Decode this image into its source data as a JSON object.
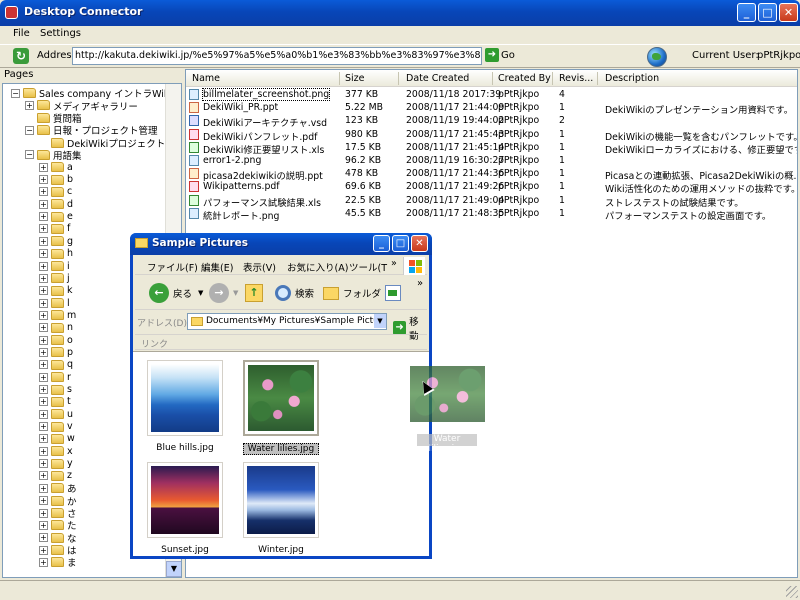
{
  "window": {
    "title": "Desktop Connector",
    "min": "_",
    "max": "□",
    "close": "✕"
  },
  "menu": {
    "file": "File",
    "settings": "Settings"
  },
  "address": {
    "label": "Address",
    "url": "http://kakuta.dekiwiki.jp/%e5%97%a5%e5%a0%b1%e3%83%bb%e3%83%97%e3%83%ad%e3%82%b8%e3%82%a7%e3",
    "go": "Go",
    "current_user_label": "Current User:",
    "current_user": "pPtRjkpo"
  },
  "tree": {
    "header": "Pages",
    "items": [
      {
        "label": "Sales company イントラWiki",
        "level": 0,
        "expander": "−",
        "folder": true
      },
      {
        "label": "メディアギャラリー",
        "level": 1,
        "expander": "+",
        "folder": true
      },
      {
        "label": "質問箱",
        "level": 1,
        "expander": "",
        "folder": true
      },
      {
        "label": "日報・プロジェクト管理",
        "level": 1,
        "expander": "−",
        "folder": true
      },
      {
        "label": "DekiWikiプロジェクト",
        "level": 2,
        "expander": "",
        "folder": true
      },
      {
        "label": "用語集",
        "level": 1,
        "expander": "−",
        "folder": true
      },
      {
        "label": "a",
        "level": 2,
        "expander": "+",
        "folder": true
      },
      {
        "label": "b",
        "level": 2,
        "expander": "+",
        "folder": true
      },
      {
        "label": "c",
        "level": 2,
        "expander": "+",
        "folder": true
      },
      {
        "label": "d",
        "level": 2,
        "expander": "+",
        "folder": true
      },
      {
        "label": "e",
        "level": 2,
        "expander": "+",
        "folder": true
      },
      {
        "label": "f",
        "level": 2,
        "expander": "+",
        "folder": true
      },
      {
        "label": "g",
        "level": 2,
        "expander": "+",
        "folder": true
      },
      {
        "label": "h",
        "level": 2,
        "expander": "+",
        "folder": true
      },
      {
        "label": "i",
        "level": 2,
        "expander": "+",
        "folder": true
      },
      {
        "label": "j",
        "level": 2,
        "expander": "+",
        "folder": true
      },
      {
        "label": "k",
        "level": 2,
        "expander": "+",
        "folder": true
      },
      {
        "label": "l",
        "level": 2,
        "expander": "+",
        "folder": true
      },
      {
        "label": "m",
        "level": 2,
        "expander": "+",
        "folder": true
      },
      {
        "label": "n",
        "level": 2,
        "expander": "+",
        "folder": true
      },
      {
        "label": "o",
        "level": 2,
        "expander": "+",
        "folder": true
      },
      {
        "label": "p",
        "level": 2,
        "expander": "+",
        "folder": true
      },
      {
        "label": "q",
        "level": 2,
        "expander": "+",
        "folder": true
      },
      {
        "label": "r",
        "level": 2,
        "expander": "+",
        "folder": true
      },
      {
        "label": "s",
        "level": 2,
        "expander": "+",
        "folder": true
      },
      {
        "label": "t",
        "level": 2,
        "expander": "+",
        "folder": true
      },
      {
        "label": "u",
        "level": 2,
        "expander": "+",
        "folder": true
      },
      {
        "label": "v",
        "level": 2,
        "expander": "+",
        "folder": true
      },
      {
        "label": "w",
        "level": 2,
        "expander": "+",
        "folder": true
      },
      {
        "label": "x",
        "level": 2,
        "expander": "+",
        "folder": true
      },
      {
        "label": "y",
        "level": 2,
        "expander": "+",
        "folder": true
      },
      {
        "label": "z",
        "level": 2,
        "expander": "+",
        "folder": true
      },
      {
        "label": "あ",
        "level": 2,
        "expander": "+",
        "folder": true
      },
      {
        "label": "か",
        "level": 2,
        "expander": "+",
        "folder": true
      },
      {
        "label": "さ",
        "level": 2,
        "expander": "+",
        "folder": true
      },
      {
        "label": "た",
        "level": 2,
        "expander": "+",
        "folder": true
      },
      {
        "label": "な",
        "level": 2,
        "expander": "+",
        "folder": true
      },
      {
        "label": "は",
        "level": 2,
        "expander": "+",
        "folder": true
      },
      {
        "label": "ま",
        "level": 2,
        "expander": "+",
        "folder": true
      }
    ],
    "scroll_down": "▼"
  },
  "files": {
    "columns": [
      "Name",
      "Size",
      "Date Created",
      "Created By",
      "Revis...",
      "Description"
    ],
    "rows": [
      {
        "icon": "png",
        "name": "billmelater_screenshot.png",
        "size": "377 KB",
        "date": "2008/11/18 2017:39",
        "by": "pPtRjkpo",
        "rev": "4",
        "desc": ""
      },
      {
        "icon": "ppt",
        "name": "DekiWiki_PR.ppt",
        "size": "5.22 MB",
        "date": "2008/11/17 21:44:09",
        "by": "pPtRjkpo",
        "rev": "1",
        "desc": "DekiWikiのプレゼンテーション用資料です。"
      },
      {
        "icon": "vsd",
        "name": "DekiWikiアーキテクチャ.vsd",
        "size": "123 KB",
        "date": "2008/11/19 19:44:02",
        "by": "pPtRjkpo",
        "rev": "2",
        "desc": ""
      },
      {
        "icon": "pdf",
        "name": "DekiWikiパンフレット.pdf",
        "size": "980 KB",
        "date": "2008/11/17 21:45:43",
        "by": "pPtRjkpo",
        "rev": "1",
        "desc": "DekiWikiの機能一覧を含むパンフレットです。"
      },
      {
        "icon": "xls",
        "name": "DekiWiki修正要望リスト.xls",
        "size": "17.5 KB",
        "date": "2008/11/17 21:45:14",
        "by": "pPtRjkpo",
        "rev": "1",
        "desc": "DekiWikiローカライズにおける、修正要望です。"
      },
      {
        "icon": "png",
        "name": "error1-2.png",
        "size": "96.2 KB",
        "date": "2008/11/19 16:30:27",
        "by": "pPtRjkpo",
        "rev": "1",
        "desc": ""
      },
      {
        "icon": "ppt",
        "name": "picasa2dekiwikiの説明.ppt",
        "size": "478 KB",
        "date": "2008/11/17 21:44:36",
        "by": "pPtRjkpo",
        "rev": "1",
        "desc": "Picasaとの連動拡張、Picasa2DekiWikiの概..."
      },
      {
        "icon": "pdf",
        "name": "Wikipatterns.pdf",
        "size": "69.6 KB",
        "date": "2008/11/17 21:49:26",
        "by": "pPtRjkpo",
        "rev": "1",
        "desc": "Wiki活性化のための運用メソッドの抜粋です。"
      },
      {
        "icon": "xls",
        "name": "パフォーマンス試験結果.xls",
        "size": "22.5 KB",
        "date": "2008/11/17 21:49:04",
        "by": "pPtRjkpo",
        "rev": "1",
        "desc": "ストレステストの試験結果です。"
      },
      {
        "icon": "png",
        "name": "統計レポート.png",
        "size": "45.5 KB",
        "date": "2008/11/17 21:48:35",
        "by": "pPtRjkpo",
        "rev": "1",
        "desc": "パフォーマンステストの設定画面です。"
      }
    ]
  },
  "explorer": {
    "title": "Sample Pictures",
    "menu": [
      "ファイル(F)",
      "編集(E)",
      "表示(V)",
      "お気に入り(A)",
      "ツール(T"
    ],
    "menu_more": "»",
    "back": "戻る",
    "search": "検索",
    "folders": "フォルダ",
    "toolbar_more": "»",
    "address_label": "アドレス(D)",
    "address_value": "Documents¥My Pictures¥Sample Pictures",
    "go": "移動",
    "links": "リンク",
    "thumbs": [
      {
        "name": "Blue hills.jpg",
        "pic": "hills",
        "selected": false
      },
      {
        "name": "Water lilies.jpg",
        "pic": "lilies",
        "selected": true
      },
      {
        "name": "Sunset.jpg",
        "pic": "sunset",
        "selected": false
      },
      {
        "name": "Winter.jpg",
        "pic": "winter",
        "selected": false
      }
    ],
    "drag_caption": "Water lilies.jpg"
  },
  "colors": {
    "titlebar": "#0846b8",
    "accent_green": "#2f9c2f",
    "close_red": "#c8391a"
  }
}
